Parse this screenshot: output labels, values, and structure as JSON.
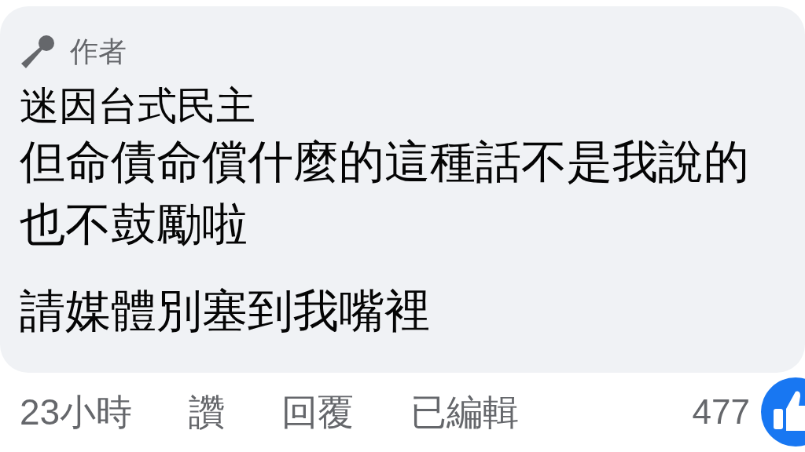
{
  "comment": {
    "badge": "作者",
    "author": "迷因台式民主",
    "paragraphs": [
      "但命債命償什麼的這種話不是我說的也不鼓勵啦",
      "請媒體別塞到我嘴裡"
    ]
  },
  "footer": {
    "time": "23小時",
    "actions": [
      "讚",
      "回覆"
    ],
    "edited": "已編輯",
    "reaction_count": "477"
  }
}
